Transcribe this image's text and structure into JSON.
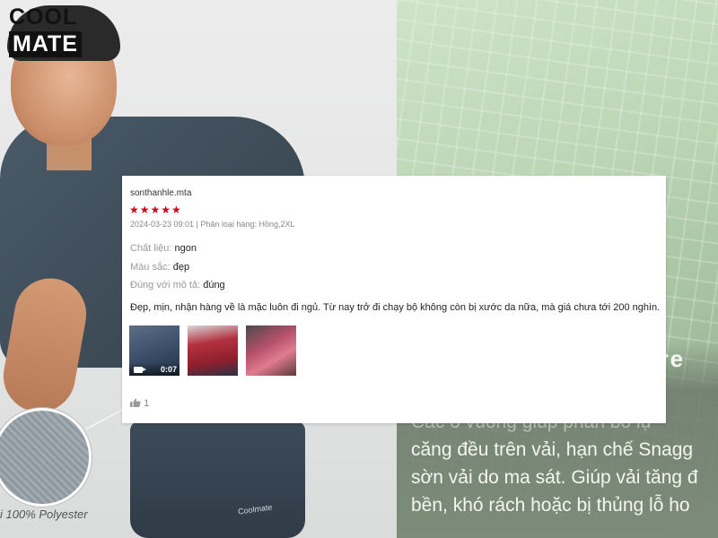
{
  "brand": {
    "logo_top": "COOL",
    "logo_bottom": "MATE"
  },
  "promo": {
    "fabric_caption": "i 100% Polyester",
    "shorts_brand": "Coolmate",
    "heading_partial": "are",
    "lines": [
      "Các ô vuông giúp phân bổ lự",
      "căng đều trên vải, hạn chế Snagg",
      "sờn vải do ma sát. Giúp vải tăng đ",
      "bền, khó rách hoặc bị thủng lỗ ho"
    ]
  },
  "review": {
    "reviewer": "sonthanhle.mta",
    "rating": 5,
    "stars": "★★★★★",
    "meta": "2024-03-23 09:01 | Phân loại hàng: Hồng,2XL",
    "attributes": [
      {
        "key": "Chất liệu:",
        "value": "ngon"
      },
      {
        "key": "Màu sắc:",
        "value": "đẹp"
      },
      {
        "key": "Đúng với mô tả:",
        "value": "đúng"
      }
    ],
    "comment": "Đẹp, mịn, nhận hàng về là mặc luôn đi ngủ. Từ nay trở đi chạy bộ không còn bị xước da nữa, mà giá chưa tới 200 nghìn.",
    "video_duration": "0:07",
    "likes": "1"
  },
  "colors": {
    "star": "#d0011b",
    "promo_green": "#bcd6b5"
  },
  "icons": [
    "video-icon",
    "thumbs-up-icon"
  ]
}
